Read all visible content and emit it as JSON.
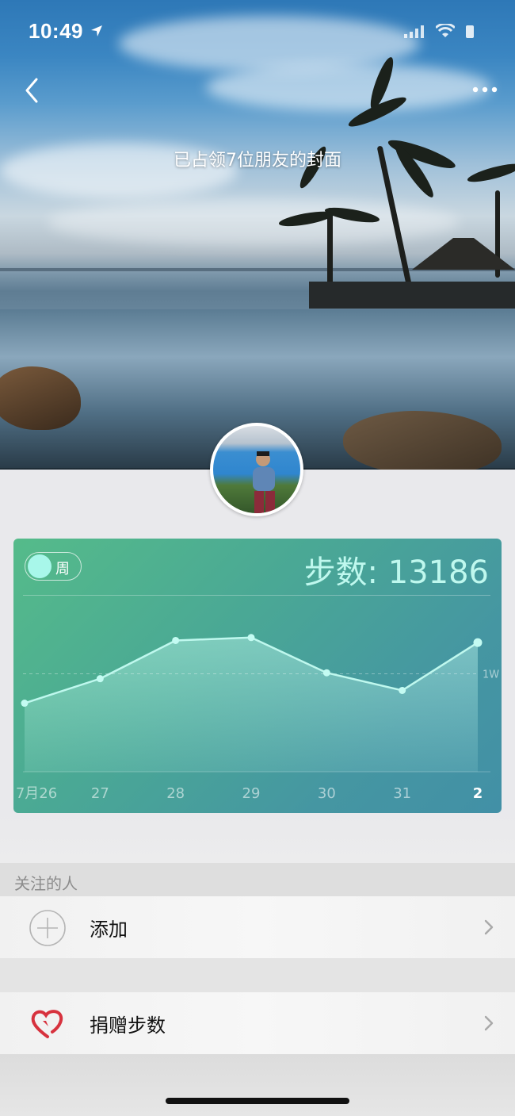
{
  "status": {
    "time": "10:49"
  },
  "cover": {
    "caption": "已占领7位朋友的封面"
  },
  "chart": {
    "toggle_label": "周",
    "steps_label": "步数: 13186",
    "reference_label": "1W",
    "accent_color": "#a8f7ea"
  },
  "chart_data": {
    "type": "area",
    "title": "步数: 13186",
    "categories": [
      "7月26",
      "27",
      "28",
      "29",
      "30",
      "31",
      "2"
    ],
    "values": [
      7000,
      9500,
      13400,
      13700,
      10100,
      8300,
      13186
    ],
    "reference_line": {
      "label": "1W",
      "value": 10000
    },
    "ylim": [
      0,
      17000
    ],
    "grid": false,
    "legend": "none"
  },
  "follow": {
    "section_title": "关注的人",
    "add_label": "添加"
  },
  "donate": {
    "label": "捐赠步数"
  },
  "icons": {
    "back": "chevron-left-icon",
    "more": "more-dots-icon",
    "add": "plus-circle-icon",
    "donate": "heart-icon",
    "chevron": "chevron-right-icon"
  }
}
